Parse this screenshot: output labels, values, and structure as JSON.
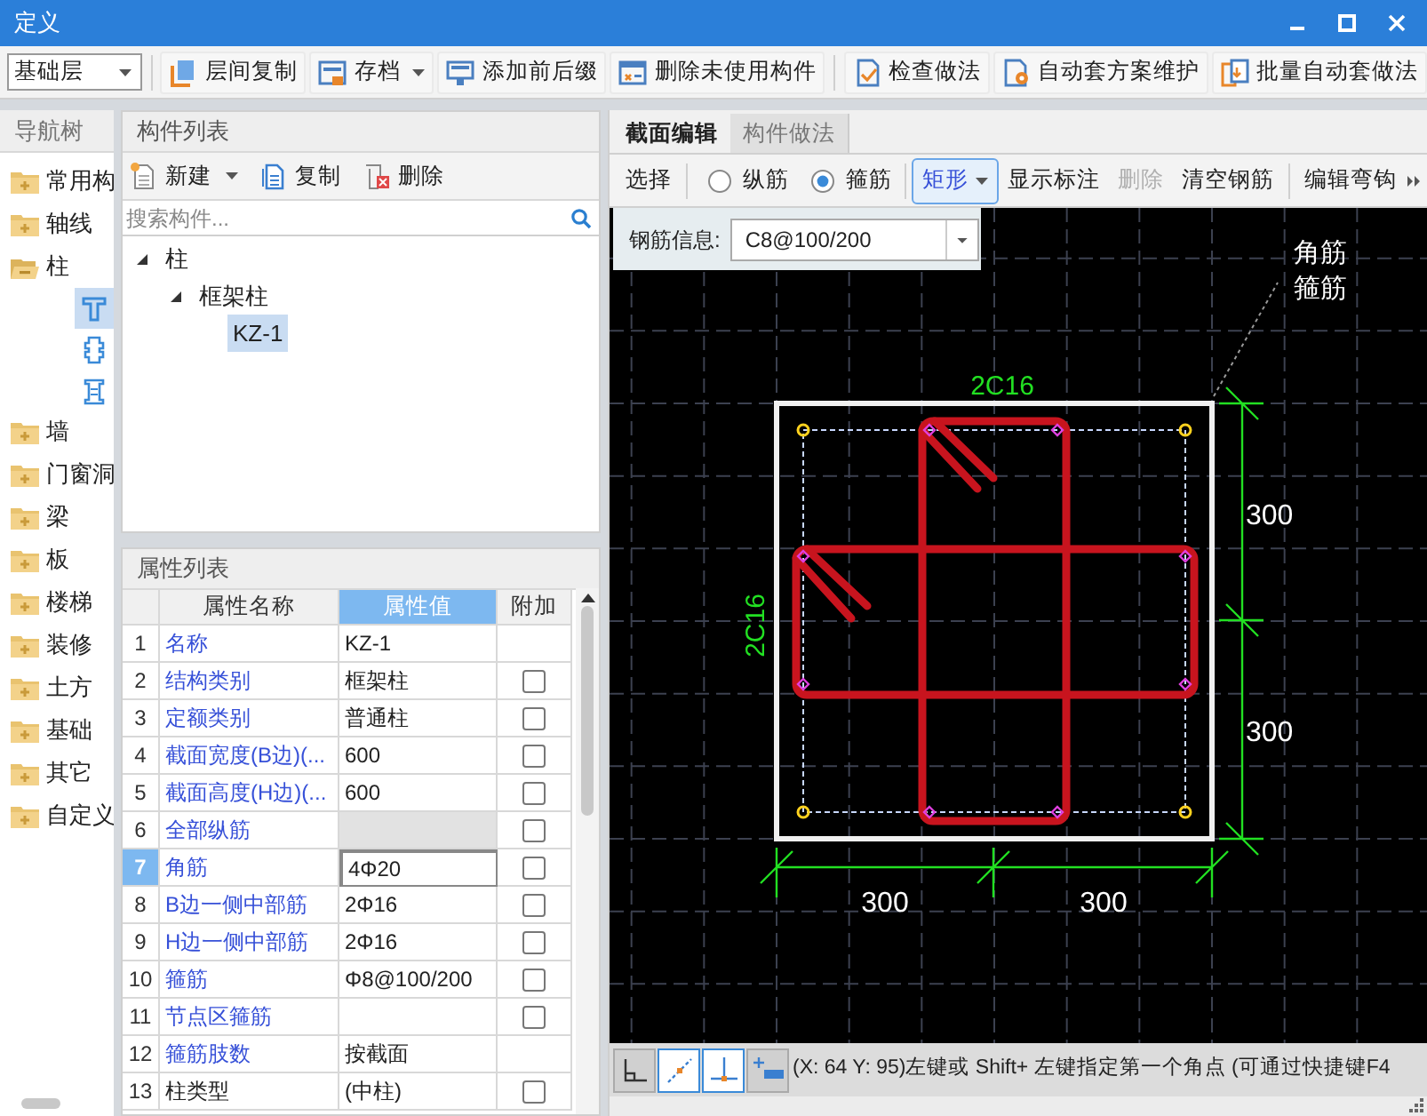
{
  "window": {
    "title": "定义"
  },
  "toolbar": {
    "floor_select": {
      "value": "基础层"
    },
    "button_groups": [
      [
        {
          "label": "层间复制",
          "dropdown": false
        },
        {
          "label": "存档",
          "dropdown": true
        },
        {
          "label": "添加前后缀",
          "dropdown": false
        },
        {
          "label": "删除未使用构件",
          "dropdown": false
        }
      ],
      [
        {
          "label": "检查做法",
          "dropdown": false
        },
        {
          "label": "自动套方案维护",
          "dropdown": false
        },
        {
          "label": "批量自动套做法",
          "dropdown": false
        }
      ]
    ]
  },
  "nav_tree": {
    "title": "导航树",
    "items": [
      {
        "label": "常用构",
        "expanded": false
      },
      {
        "label": "轴线",
        "expanded": false
      },
      {
        "label": "柱",
        "expanded": true,
        "children": [
          {
            "selected": true
          },
          {
            "selected": false
          },
          {
            "selected": false
          }
        ]
      },
      {
        "label": "墙",
        "expanded": false
      },
      {
        "label": "门窗洞",
        "expanded": false
      },
      {
        "label": "梁",
        "expanded": false
      },
      {
        "label": "板",
        "expanded": false
      },
      {
        "label": "楼梯",
        "expanded": false
      },
      {
        "label": "装修",
        "expanded": false
      },
      {
        "label": "土方",
        "expanded": false
      },
      {
        "label": "基础",
        "expanded": false
      },
      {
        "label": "其它",
        "expanded": false
      },
      {
        "label": "自定义",
        "expanded": false
      }
    ]
  },
  "component_list": {
    "title": "构件列表",
    "toolbar": [
      {
        "label": "新建",
        "dropdown": true
      },
      {
        "label": "复制",
        "dropdown": false
      },
      {
        "label": "删除",
        "dropdown": false
      }
    ],
    "search": {
      "placeholder": "搜索构件..."
    },
    "tree": [
      {
        "label": "柱",
        "expanded": true,
        "selected": false,
        "children": [
          {
            "label": "框架柱",
            "expanded": true,
            "selected": false,
            "children": [
              {
                "label": "KZ-1",
                "selected": true
              }
            ]
          }
        ]
      }
    ]
  },
  "properties": {
    "title": "属性列表",
    "columns": [
      {
        "label": "属性名称",
        "selected": false
      },
      {
        "label": "属性值",
        "selected": true
      },
      {
        "label": "附加",
        "selected": false
      }
    ],
    "rows": [
      {
        "index": "1",
        "name": "名称",
        "value": "KZ-1",
        "public": true,
        "selected": false,
        "disabled": false
      },
      {
        "index": "2",
        "name": "结构类别",
        "value": "框架柱",
        "public": true,
        "selected": false,
        "disabled": false,
        "checked": false
      },
      {
        "index": "3",
        "name": "定额类别",
        "value": "普通柱",
        "public": true,
        "selected": false,
        "disabled": false,
        "checked": false
      },
      {
        "index": "4",
        "name": "截面宽度(B边)(...",
        "value": "600",
        "public": true,
        "selected": false,
        "disabled": false,
        "checked": false
      },
      {
        "index": "5",
        "name": "截面高度(H边)(...",
        "value": "600",
        "public": true,
        "selected": false,
        "disabled": false,
        "checked": false
      },
      {
        "index": "6",
        "name": "全部纵筋",
        "public": true,
        "selected": false,
        "disabled": true,
        "checked": false
      },
      {
        "index": "7",
        "name": "角筋",
        "value": "4Φ20",
        "public": true,
        "selected": true,
        "disabled": false,
        "checked": false
      },
      {
        "index": "8",
        "name": "B边一侧中部筋",
        "value": "2Φ16",
        "public": true,
        "selected": false,
        "disabled": false,
        "checked": false
      },
      {
        "index": "9",
        "name": "H边一侧中部筋",
        "value": "2Φ16",
        "public": true,
        "selected": false,
        "disabled": false,
        "checked": false
      },
      {
        "index": "10",
        "name": "箍筋",
        "value": "Φ8@100/200",
        "public": true,
        "selected": false,
        "disabled": false,
        "checked": false
      },
      {
        "index": "11",
        "name": "节点区箍筋",
        "public": true,
        "selected": false,
        "disabled": false,
        "checked": false
      },
      {
        "index": "12",
        "name": "箍筋肢数",
        "value": "按截面",
        "public": true,
        "selected": false,
        "disabled": false
      },
      {
        "index": "13",
        "name": "柱类型",
        "value": "(中柱)",
        "public": false,
        "selected": false,
        "disabled": false,
        "checked": false
      }
    ]
  },
  "section_editor": {
    "tabs": [
      {
        "label": "截面编辑",
        "selected": true
      },
      {
        "label": "构件做法",
        "selected": false
      }
    ],
    "toolbar_groups": [
      [
        {
          "kind": "button",
          "label": "选择",
          "disabled": false
        }
      ],
      [
        {
          "kind": "radio",
          "label": "纵筋",
          "selected": false
        },
        {
          "kind": "radio",
          "label": "箍筋",
          "selected": true
        }
      ],
      [
        {
          "kind": "dropdown",
          "label": "矩形"
        },
        {
          "kind": "button",
          "label": "显示标注",
          "disabled": false
        },
        {
          "kind": "button",
          "label": "删除",
          "disabled": true
        },
        {
          "kind": "button",
          "label": "清空钢筋",
          "disabled": false
        }
      ],
      [
        {
          "kind": "button",
          "label": "编辑弯钩",
          "disabled": false
        }
      ]
    ],
    "rebar_info": {
      "label": "钢筋信息:",
      "value": "C8@100/200"
    },
    "canvas": {
      "legend": [
        "角筋",
        "箍筋"
      ],
      "top_rebar_label": "2C16",
      "side_rebar_label": "2C16",
      "dimension_labels": [
        "300",
        "300",
        "300",
        "300"
      ]
    }
  },
  "status_bar": {
    "snap_buttons": [
      {
        "selected": false
      },
      {
        "selected": true
      },
      {
        "selected": true
      },
      {
        "selected": false
      }
    ],
    "message": "(X: 64 Y: 95)左键或 Shift+ 左键指定第一个角点 (可通过快捷键F4"
  }
}
